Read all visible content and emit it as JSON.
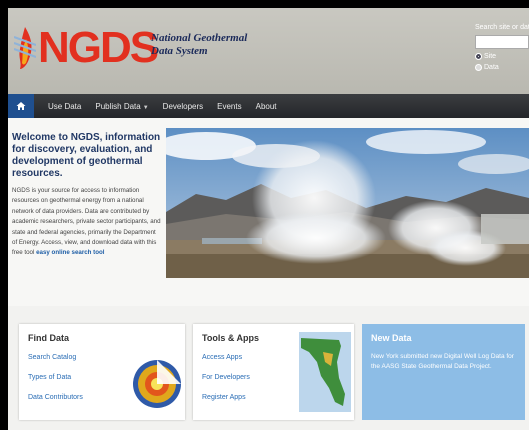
{
  "header": {
    "logo_text": "NGDS",
    "tagline_line1": "National Geothermal",
    "tagline_line2": "Data System",
    "search_label": "Search site or data",
    "search_placeholder": "",
    "radio_site": "Site",
    "radio_data": "Data"
  },
  "nav": {
    "items": [
      {
        "label": "Use Data"
      },
      {
        "label": "Publish Data"
      },
      {
        "label": "Developers"
      },
      {
        "label": "Events"
      },
      {
        "label": "About"
      }
    ]
  },
  "welcome": {
    "title": "Welcome to NGDS, information for discovery, evaluation, and development of geothermal resources.",
    "body": "NGDS is your source for access to information resources on geothermal energy from a national network of data providers. Data are contributed by academic researchers, private sector participants, and state and federal agencies, primarily the Department of Energy. Access, view, and download data with this free tool ",
    "link": "easy online search tool"
  },
  "cards": {
    "find": {
      "title": "Find Data",
      "links": [
        "Search Catalog",
        "Types of Data",
        "Data Contributors"
      ]
    },
    "tools": {
      "title": "Tools & Apps",
      "links": [
        "Access Apps",
        "For Developers",
        "Register Apps"
      ]
    },
    "news": {
      "title": "New Data",
      "text": "New York submitted new Digital Well Log Data for the AASG State Geothermal Data Project."
    }
  },
  "colors": {
    "logo_red": "#e2301f",
    "nav_bg": "#2b2d31",
    "nav_home": "#1f4f8f",
    "title_blue": "#213865",
    "link_blue": "#2a6db5",
    "news_card": "#8dbde6"
  }
}
